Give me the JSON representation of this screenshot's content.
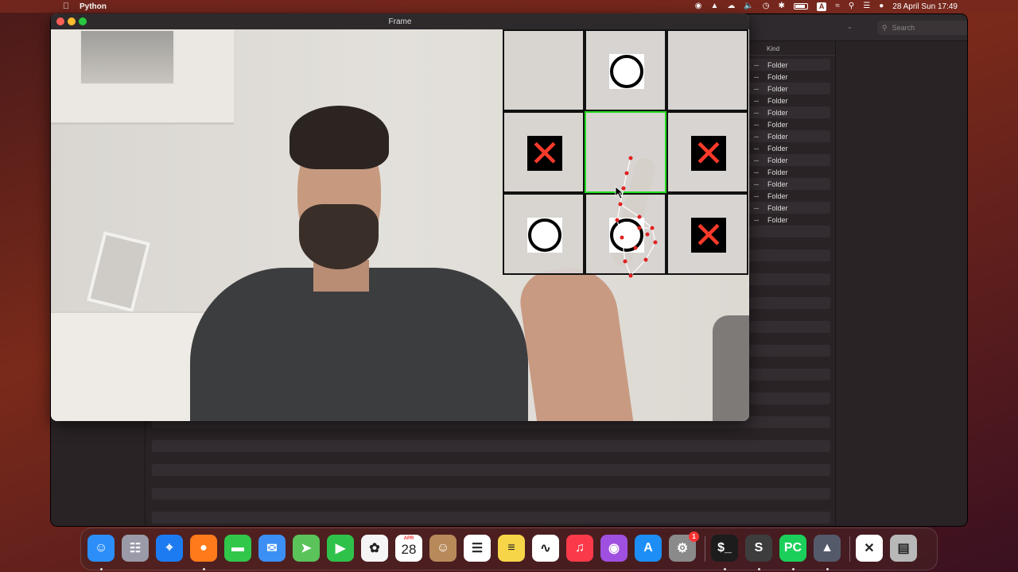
{
  "menubar": {
    "app_name": "Python",
    "input_badge": "A",
    "date_time": "28 April Sun  17:49"
  },
  "finder": {
    "search_placeholder": "Search",
    "column_kind": "Kind",
    "rows": [
      {
        "size": "--",
        "kind": "Folder"
      },
      {
        "size": "--",
        "kind": "Folder"
      },
      {
        "size": "--",
        "kind": "Folder"
      },
      {
        "size": "--",
        "kind": "Folder"
      },
      {
        "size": "--",
        "kind": "Folder"
      },
      {
        "size": "--",
        "kind": "Folder"
      },
      {
        "size": "--",
        "kind": "Folder"
      },
      {
        "size": "--",
        "kind": "Folder"
      },
      {
        "size": "--",
        "kind": "Folder"
      },
      {
        "size": "--",
        "kind": "Folder"
      },
      {
        "size": "--",
        "kind": "Folder"
      },
      {
        "size": "--",
        "kind": "Folder"
      },
      {
        "size": "--",
        "kind": "Folder"
      },
      {
        "size": "--",
        "kind": "Folder"
      }
    ]
  },
  "frame_window": {
    "title": "Frame"
  },
  "board": {
    "cells": [
      "",
      "O",
      "",
      "X",
      "",
      "X",
      "O",
      "O",
      "X"
    ],
    "active_cell": 4,
    "colors": {
      "x": "#ff3a2a",
      "o": "#000000",
      "grid": "#111111",
      "active": "#22dd22"
    }
  },
  "dock": {
    "items": [
      {
        "name": "finder-icon",
        "running": true
      },
      {
        "name": "launchpad-icon",
        "running": false
      },
      {
        "name": "safari-icon",
        "running": false
      },
      {
        "name": "firefox-icon",
        "running": true
      },
      {
        "name": "messages-icon",
        "running": false
      },
      {
        "name": "mail-icon",
        "running": false
      },
      {
        "name": "maps-icon",
        "running": false
      },
      {
        "name": "facetime-icon",
        "running": false
      },
      {
        "name": "photos-icon",
        "running": false
      },
      {
        "name": "calendar-icon",
        "running": false,
        "month": "APR",
        "day": "28"
      },
      {
        "name": "contacts-icon",
        "running": false
      },
      {
        "name": "reminders-icon",
        "running": false
      },
      {
        "name": "notes-icon",
        "running": false
      },
      {
        "name": "freeform-icon",
        "running": false
      },
      {
        "name": "music-icon",
        "running": false
      },
      {
        "name": "podcasts-icon",
        "running": false
      },
      {
        "name": "app-store-icon",
        "running": false
      },
      {
        "name": "system-settings-icon",
        "running": false,
        "badge": "1"
      },
      {
        "name": "terminal-icon",
        "running": true
      },
      {
        "name": "sublime-text-icon",
        "running": true
      },
      {
        "name": "pycharm-icon",
        "running": true
      },
      {
        "name": "python-rocket-icon",
        "running": true
      },
      {
        "name": "x11-icon",
        "running": false
      },
      {
        "name": "trash-icon",
        "running": false
      }
    ]
  }
}
